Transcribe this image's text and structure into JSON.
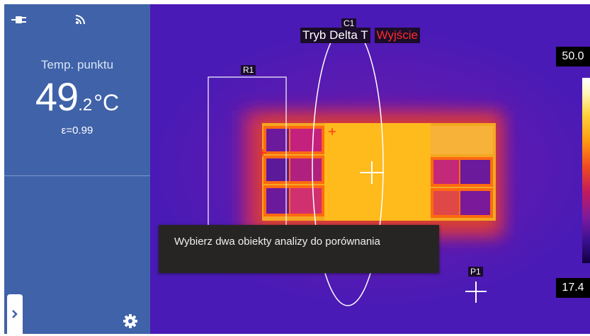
{
  "sidebar": {
    "readout_label": "Temp. punktu",
    "readout_value_int": "49",
    "readout_value_dec": ".2",
    "readout_unit": "°C",
    "emissivity": "ε=0.99",
    "icons": [
      "power-plug-icon",
      "wifi-signal-icon",
      "chevron-right-icon",
      "gear-icon"
    ]
  },
  "thermal": {
    "mode_label": "Tryb Delta T",
    "exit_label": "Wyjście",
    "tags": {
      "c1": "C1",
      "r1": "R1",
      "p1": "P1"
    },
    "scale": {
      "max": "50.0",
      "min": "17.4"
    }
  },
  "toast": {
    "message": "Wybierz dwa obiekty analizy do porównania"
  },
  "colors": {
    "panel": "#3f62a8",
    "exit": "#ff2a2a",
    "toast": "#272524",
    "background": "#4a1ab6"
  }
}
